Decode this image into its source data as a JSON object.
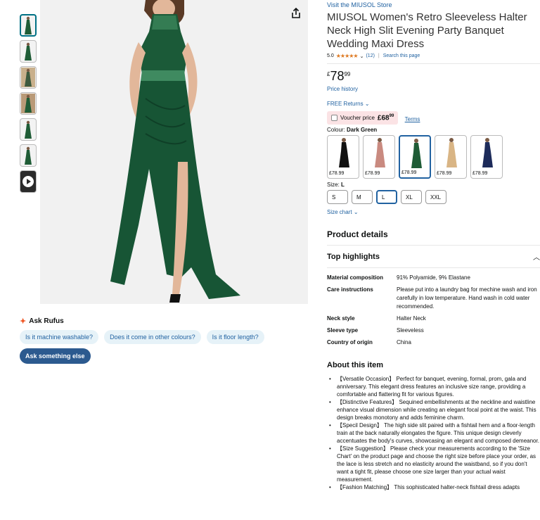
{
  "thumbnails": [
    {
      "color": "#1f5c36"
    },
    {
      "color": "#1f5c36"
    },
    {
      "color": "#3d5a3e"
    },
    {
      "color": "#1f5c36"
    },
    {
      "color": "#1f5c36"
    },
    {
      "color": "#1f5c36"
    },
    {
      "color": "#2b2b2b",
      "video": true
    }
  ],
  "main_image": {
    "dress_color": "#175535",
    "background": "#f1f1f1"
  },
  "rufus": {
    "title": "Ask Rufus",
    "suggestions": [
      "Is it machine washable?",
      "Does it come in other colours?",
      "Is it floor length?"
    ],
    "ask_button": "Ask something else"
  },
  "product": {
    "store_link": "Visit the MIUSOL Store",
    "title": "MIUSOL Women's Retro Sleeveless Halter Neck High Slit Evening Party Banquet Wedding Maxi Dress",
    "rating": "5.0",
    "stars": "★★★★★",
    "review_count": "(12)",
    "search_page": "Search this page",
    "price": {
      "currency": "£",
      "whole": "78",
      "fraction": "99"
    },
    "price_history": "Price history",
    "free_returns": "FREE Returns",
    "voucher": {
      "label": "Voucher price",
      "price": "£68",
      "price_fraction": "99",
      "terms": "Terms"
    },
    "colour": {
      "label": "Colour:",
      "value": "Dark Green"
    },
    "swatches": [
      {
        "price": "£78.99",
        "color": "#111111"
      },
      {
        "price": "£78.99",
        "color": "#c98a80"
      },
      {
        "price": "£78.99",
        "color": "#1f5c36",
        "selected": true
      },
      {
        "price": "£78.99",
        "color": "#d9b585"
      },
      {
        "price": "£78.99",
        "color": "#1d2b5a"
      }
    ],
    "size": {
      "label": "Size:",
      "value": "L"
    },
    "sizes": [
      "S",
      "M",
      "L",
      "XL",
      "XXL"
    ],
    "size_chart": "Size chart"
  },
  "details": {
    "heading": "Product details",
    "highlights_heading": "Top highlights",
    "specs": [
      {
        "key": "Material composition",
        "value": "91% Polyamide, 9% Elastane"
      },
      {
        "key": "Care instructions",
        "value": "Please put into a laundry bag for mechine wash and iron carefully in low temperature. Hand wash in cold water recommended."
      },
      {
        "key": "Neck style",
        "value": "Halter Neck"
      },
      {
        "key": "Sleeve type",
        "value": "Sleeveless"
      },
      {
        "key": "Country of origin",
        "value": "China"
      }
    ]
  },
  "about": {
    "heading": "About this item",
    "items": [
      "【Versatile Occasion】 Perfect for banquet, evening, formal, prom, gala and anniversary. This elegant dress features an inclusive size range, providing a comfortable and flattering fit for various figures.",
      "【Distinctive Features】 Sequined embellishments at the neckline and waistline enhance visual dimension while creating an elegant focal point at the waist. This design breaks monotony and adds feminine charm.",
      "【Specil Design】 The high side slit paired with a fishtail hem and a floor-length train at the back naturally elongates the figure. This unique design cleverly accentuates the body's curves, showcasing an elegant and composed demeanor.",
      "【Size Suggestion】 Please check your measurements according to the 'Size Chart' on the product page and choose the right size before place your order, as the lace is less stretch and no elasticity around the waistband, so if you don't want a tight fit, please choose one size larger than your actual waist measurement.",
      "【Fashion Matching】 This sophisticated halter-neck fishtail dress adapts"
    ]
  }
}
